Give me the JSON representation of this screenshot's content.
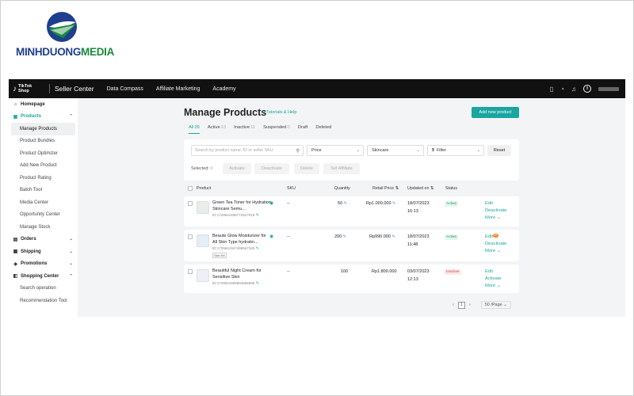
{
  "watermark": {
    "part1": "MINHDUONG",
    "part2": "MEDIA"
  },
  "colors": {
    "accent": "#1aa5a0",
    "topbar": "#111111",
    "active_status": "#1a9a6a",
    "inactive_status": "#d43a3a"
  },
  "topbar": {
    "logo_glyph": "♪",
    "logo_line1": "TikTok",
    "logo_line2": "Shop",
    "title": "Seller Center",
    "nav": [
      "Data Compass",
      "Affiliate Marketing",
      "Academy"
    ],
    "icons": [
      "phone-icon",
      "headset-icon",
      "bell-icon",
      "avatar"
    ],
    "icon_glyphs": {
      "phone": "▯",
      "headset": "◔",
      "bell": "♪",
      "avatar": "8"
    }
  },
  "sidebar": {
    "items": [
      {
        "label": "Homepage",
        "icon": "⌂",
        "level": "top"
      },
      {
        "label": "Products",
        "icon": "▣",
        "level": "top",
        "chevron": "⌃",
        "teal": true
      },
      {
        "label": "Manage Products",
        "level": "sub",
        "active": true
      },
      {
        "label": "Product Bundles",
        "level": "sub"
      },
      {
        "label": "Product Optimizer",
        "level": "sub"
      },
      {
        "label": "Add New Product",
        "level": "sub"
      },
      {
        "label": "Product Rating",
        "level": "sub"
      },
      {
        "label": "Batch Tool",
        "level": "sub"
      },
      {
        "label": "Media Center",
        "level": "sub"
      },
      {
        "label": "Opportunity Center",
        "level": "sub"
      },
      {
        "label": "Manage Stock",
        "level": "sub"
      },
      {
        "label": "Orders",
        "icon": "▤",
        "level": "top",
        "chevron": "⌄"
      },
      {
        "label": "Shipping",
        "icon": "▦",
        "level": "top",
        "chevron": "⌄"
      },
      {
        "label": "Promotions",
        "icon": "◈",
        "level": "top",
        "chevron": "⌄"
      },
      {
        "label": "Shopping Center",
        "icon": "◧",
        "level": "top",
        "chevron": "⌃"
      },
      {
        "label": "Search operation",
        "level": "sub"
      },
      {
        "label": "Recommendation Tool",
        "level": "sub"
      }
    ]
  },
  "main": {
    "title": "Manage Products",
    "tutorials_icon": "⚲",
    "tutorials": "Tutorials & Help",
    "add_button": "Add new product",
    "tabs": [
      {
        "label": "All",
        "count": "26",
        "active": true
      },
      {
        "label": "Active",
        "count": "13"
      },
      {
        "label": "Inactive",
        "count": "11"
      },
      {
        "label": "Suspended",
        "count": "0"
      },
      {
        "label": "Draft",
        "count": ""
      },
      {
        "label": "Deleted",
        "count": ""
      }
    ],
    "filters": {
      "search_placeholder": "Search by product name, ID or seller SKU",
      "search_icon": "⚲",
      "price": "Price",
      "category": "Skincare",
      "filter_icon": "⩩",
      "filter": "Filter",
      "chevron": "⌄",
      "reset": "Reset",
      "selected_label": "Selected:",
      "selected_count": "0",
      "bulk": [
        "Activate",
        "Deactivate",
        "Delete",
        "Set Affiliate"
      ]
    },
    "columns": [
      "Product",
      "SKU",
      "Quantity",
      "Retail Price",
      "Updated on",
      "Status"
    ],
    "sort_icon": "⇅",
    "products": [
      {
        "name": "Green Tea Toner for Hydration Skincare Semu...",
        "id": "ID:1729641936772827919",
        "eye": "◉",
        "edit_icon": "✎",
        "sku": "--",
        "quantity": "50",
        "price": "Rp1.000.000",
        "updated_date": "18/07/2023",
        "updated_time": "16:13",
        "status": "Active",
        "actions": [
          "Edit",
          "Deactivate",
          "More"
        ],
        "tag": ""
      },
      {
        "name": "Beaute Glow Moisturizer for All Skin Type hydratin...",
        "id": "ID:1729641947499567183",
        "eye": "◉",
        "edit_icon": "✎",
        "sku": "--",
        "quantity": "200",
        "price": "Rp990.000",
        "updated_date": "18/07/2023",
        "updated_time": "11:48",
        "status": "Active",
        "actions": [
          "Edit",
          "Deactivate",
          "More"
        ],
        "notification": "9+",
        "tag": "Skin Kit"
      },
      {
        "name": "Beautiful Night Cream for Sensitive Skin",
        "id": "ID:1729641959894666895",
        "edit_icon": "✎",
        "sku": "--",
        "quantity": "100",
        "price": "Rp1.800.000",
        "updated_date": "03/07/2023",
        "updated_time": "12:13",
        "status": "Inactive",
        "actions": [
          "Edit",
          "Activate",
          "More"
        ],
        "tag": ""
      }
    ],
    "more_chevron": "⌄",
    "pagination": {
      "prev": "‹",
      "page": "1",
      "next": "›",
      "page_size": "50 /Page",
      "chevron": "⌄"
    }
  }
}
